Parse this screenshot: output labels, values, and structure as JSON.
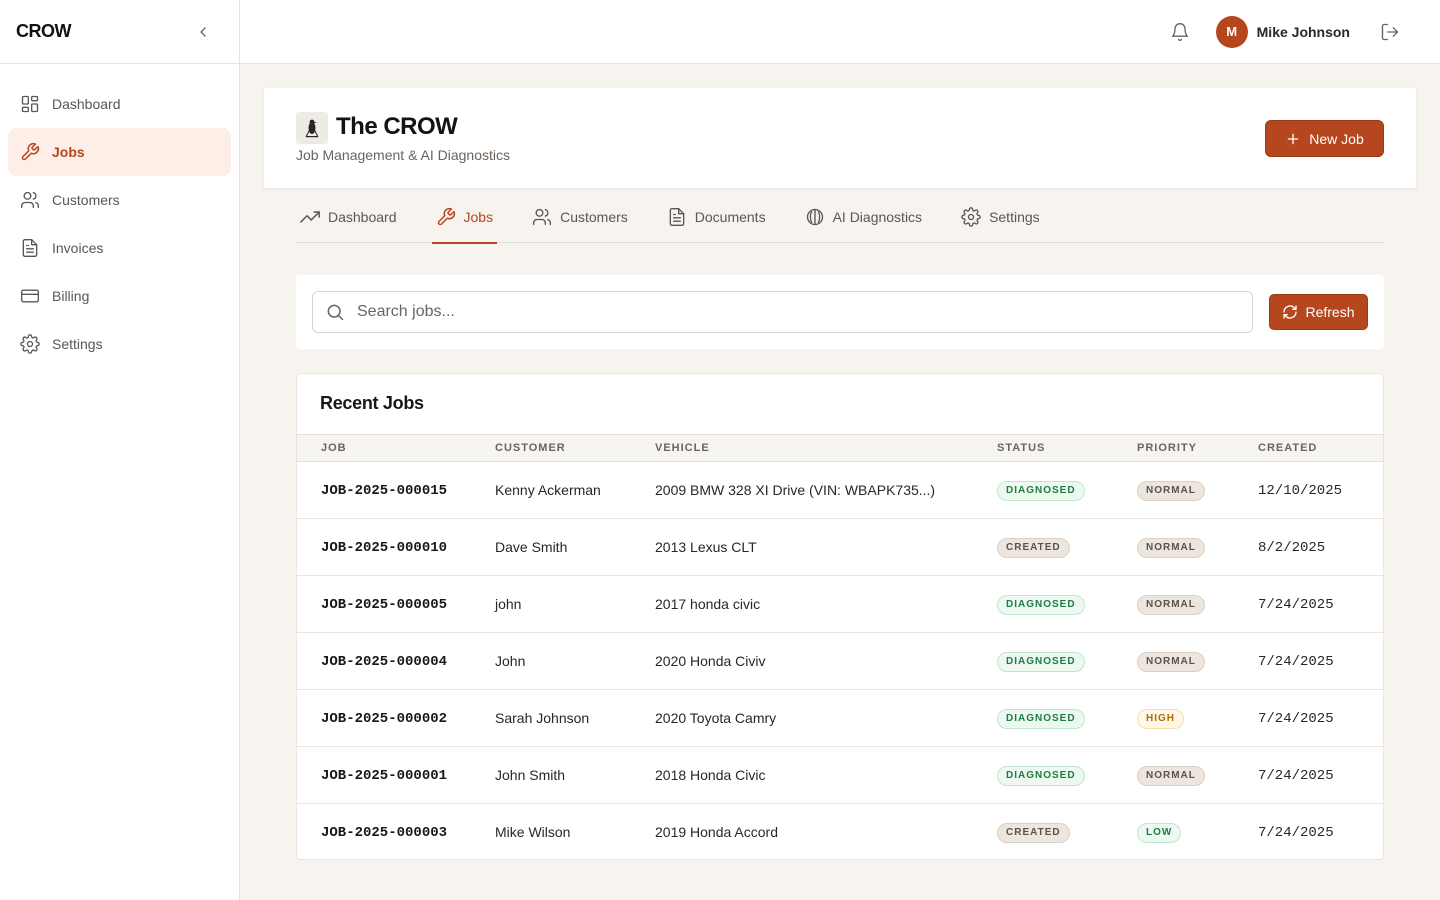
{
  "sidebar": {
    "brand": "CROW",
    "items": [
      {
        "label": "Dashboard",
        "icon": "layout-dashboard-icon"
      },
      {
        "label": "Jobs",
        "icon": "wrench-icon",
        "active": true
      },
      {
        "label": "Customers",
        "icon": "users-icon"
      },
      {
        "label": "Invoices",
        "icon": "file-text-icon"
      },
      {
        "label": "Billing",
        "icon": "credit-card-icon"
      },
      {
        "label": "Settings",
        "icon": "gear-icon"
      }
    ]
  },
  "topbar": {
    "user_initial": "M",
    "user_name": "Mike Johnson"
  },
  "header": {
    "title": "The CROW",
    "subtitle": "Job Management & AI Diagnostics",
    "new_job_label": "New Job"
  },
  "tabs": [
    {
      "label": "Dashboard",
      "icon": "trending-up-icon"
    },
    {
      "label": "Jobs",
      "icon": "wrench-icon",
      "active": true
    },
    {
      "label": "Customers",
      "icon": "users-icon"
    },
    {
      "label": "Documents",
      "icon": "file-text-icon"
    },
    {
      "label": "AI Diagnostics",
      "icon": "brain-icon"
    },
    {
      "label": "Settings",
      "icon": "gear-icon"
    }
  ],
  "search": {
    "placeholder": "Search jobs...",
    "refresh_label": "Refresh"
  },
  "jobs": {
    "title": "Recent Jobs",
    "columns": [
      "JOB",
      "CUSTOMER",
      "VEHICLE",
      "STATUS",
      "PRIORITY",
      "CREATED"
    ],
    "rows": [
      {
        "job": "JOB-2025-000015",
        "customer": "Kenny Ackerman",
        "vehicle": "2009 BMW 328 XI Drive (VIN: WBAPK735...)",
        "status": "DIAGNOSED",
        "priority": "NORMAL",
        "created": "12/10/2025"
      },
      {
        "job": "JOB-2025-000010",
        "customer": "Dave Smith",
        "vehicle": "2013 Lexus CLT",
        "status": "CREATED",
        "priority": "NORMAL",
        "created": "8/2/2025"
      },
      {
        "job": "JOB-2025-000005",
        "customer": "john",
        "vehicle": "2017 honda civic",
        "status": "DIAGNOSED",
        "priority": "NORMAL",
        "created": "7/24/2025"
      },
      {
        "job": "JOB-2025-000004",
        "customer": "John",
        "vehicle": "2020 Honda Civiv",
        "status": "DIAGNOSED",
        "priority": "NORMAL",
        "created": "7/24/2025"
      },
      {
        "job": "JOB-2025-000002",
        "customer": "Sarah Johnson",
        "vehicle": "2020 Toyota Camry",
        "status": "DIAGNOSED",
        "priority": "HIGH",
        "created": "7/24/2025"
      },
      {
        "job": "JOB-2025-000001",
        "customer": "John Smith",
        "vehicle": "2018 Honda Civic",
        "status": "DIAGNOSED",
        "priority": "NORMAL",
        "created": "7/24/2025"
      },
      {
        "job": "JOB-2025-000003",
        "customer": "Mike Wilson",
        "vehicle": "2019 Honda Accord",
        "status": "CREATED",
        "priority": "LOW",
        "created": "7/24/2025"
      }
    ]
  },
  "colors": {
    "accent": "#b5461d",
    "accent_bg": "#fdeee7",
    "page_bg": "#f7f4f0"
  }
}
